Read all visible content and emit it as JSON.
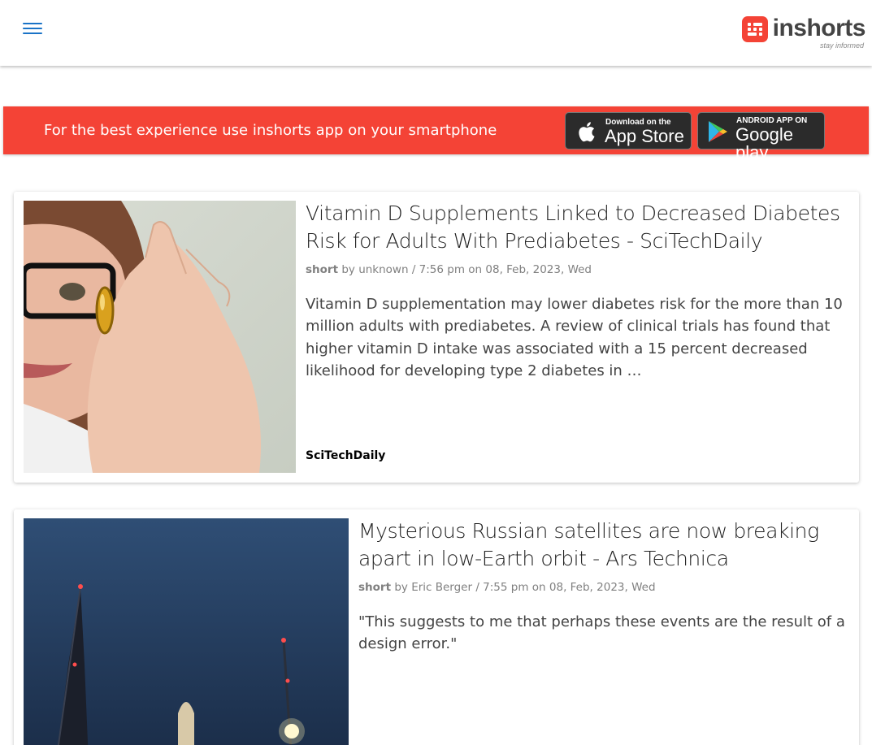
{
  "header": {
    "logo_text": "inshorts",
    "logo_tagline": "stay informed"
  },
  "app_banner": {
    "text": "For the best experience use inshorts app on your smartphone",
    "app_store": {
      "small": "Download on the",
      "big": "App Store"
    },
    "google_play": {
      "small": "ANDROID APP ON",
      "big": "Google play"
    }
  },
  "articles": [
    {
      "headline": "Vitamin D Supplements Linked to Decreased Diabetes Risk for Adults With Prediabetes - SciTechDaily",
      "short_label": "short",
      "byline": " by unknown / 7:56 pm on 08, Feb, 2023, Wed",
      "content": "Vitamin D supplementation may lower diabetes risk for the more than 10 million adults with prediabetes. A review of clinical trials has found that higher vitamin D intake was associated with a 15 percent decreased likelihood for developing type 2 diabetes in …",
      "source": "SciTechDaily"
    },
    {
      "headline": "Mysterious Russian satellites are now breaking apart in low-Earth orbit - Ars Technica",
      "short_label": "short",
      "byline": " by Eric Berger / 7:55 pm on 08, Feb, 2023, Wed",
      "content": "\"This suggests to me that perhaps these events are the result of a design error.\""
    }
  ],
  "colors": {
    "brand_red": "#f44336",
    "menu_blue": "#1a73c7"
  }
}
